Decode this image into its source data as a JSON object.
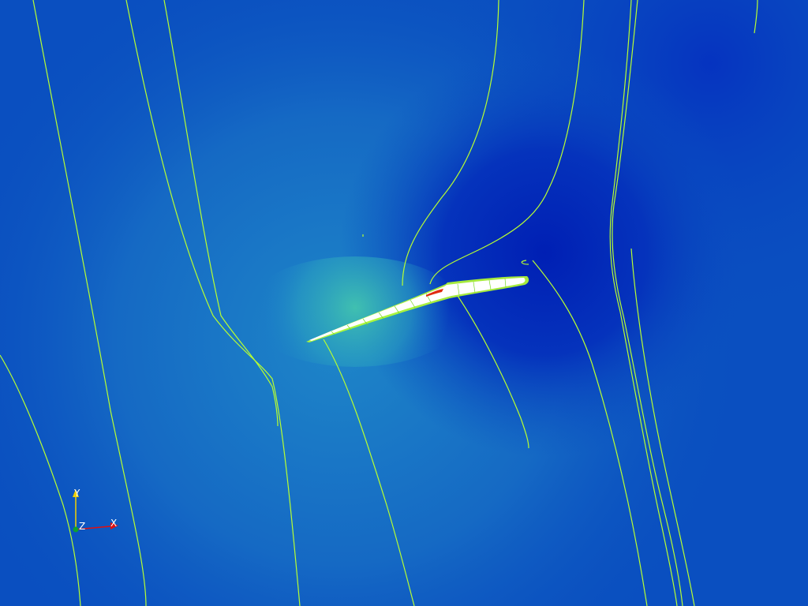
{
  "colors": {
    "background_base": "#0a4fc0",
    "background_light": "#1a7fc8",
    "background_deep": "#0028b8",
    "streamline": "#b8ff30",
    "airfoil_fill": "#ffffff",
    "hot_spot": "#e02a10",
    "axis_x": "#e01010",
    "axis_y": "#f0d000",
    "axis_z": "#10a030"
  },
  "orientation_axes": {
    "x_label": "X",
    "y_label": "Y",
    "z_label": "Z"
  }
}
